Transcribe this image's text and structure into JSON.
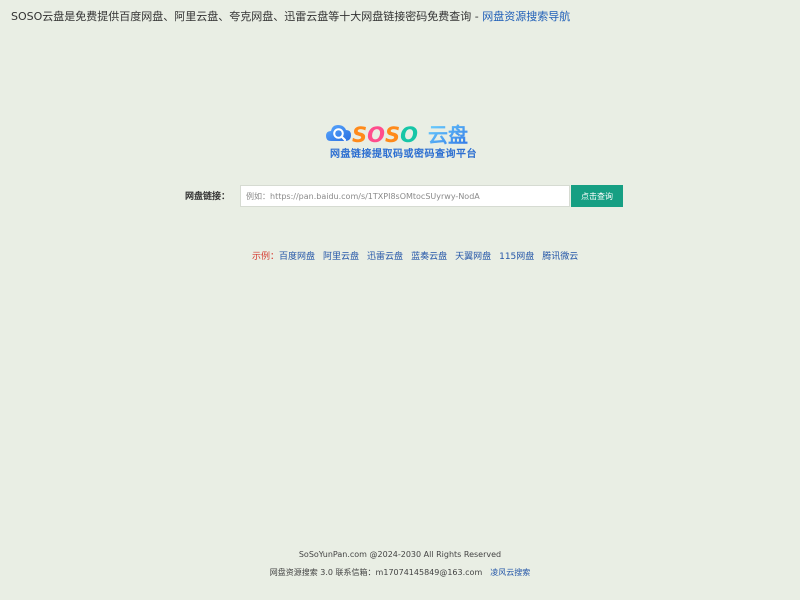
{
  "header": {
    "description": "SOSO云盘是免费提供百度网盘、阿里云盘、夸克网盘、迅雷云盘等十大网盘链接密码免费查询 -",
    "nav_link": "网盘资源搜索导航"
  },
  "logo": {
    "text_soso": "SOSO",
    "text_cn": "云盘",
    "subtitle": "网盘链接提取码或密码查询平台"
  },
  "search": {
    "label": "网盘链接：",
    "placeholder": "例如：https://pan.baidu.com/s/1TXPI8sOMtocSUyrwy-NodA",
    "button": "点击查询"
  },
  "examples": {
    "prefix": "示例：",
    "items": [
      "百度网盘",
      "阿里云盘",
      "迅雷云盘",
      "蓝奏云盘",
      "天翼网盘",
      "115网盘",
      "腾讯微云"
    ]
  },
  "footer": {
    "copyright": "SoSoYunPan.com @2024-2030 All Rights Reserved",
    "version_contact": "网盘资源搜索 3.0 联系信箱：m17074145849@163.com",
    "partner_link": "凌风云搜索"
  },
  "colors": {
    "background": "#e9eee4",
    "link": "#2456a8",
    "button": "#169f83",
    "example_prefix": "#d53a2f"
  }
}
